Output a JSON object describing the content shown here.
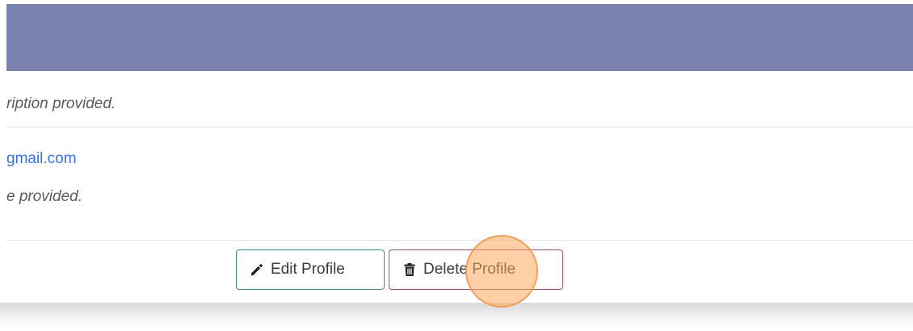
{
  "profile": {
    "description_text": "ription provided.",
    "email_text": "gmail.com",
    "phone_text": "e provided."
  },
  "actions": {
    "edit_label": "Edit Profile",
    "edit_icon": "pencil-icon",
    "delete_label": "Delete Profile",
    "delete_icon": "trash-icon"
  },
  "colors": {
    "header": "#7a82ad",
    "link": "#3a6fe0",
    "edit_border": "#3f8f8a",
    "delete_border": "#a04b78",
    "click_highlight": "#ffaa5f"
  }
}
